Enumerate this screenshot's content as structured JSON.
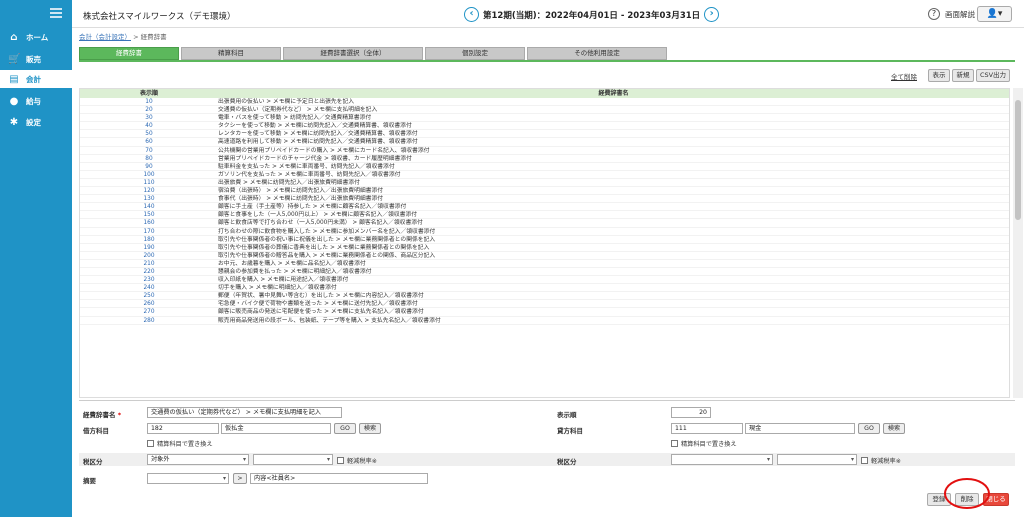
{
  "sidebar": {
    "items": [
      {
        "label": "ホーム",
        "icon": "home-icon",
        "glyph": "⌂"
      },
      {
        "label": "販売",
        "icon": "cart-icon",
        "glyph": "🛒"
      },
      {
        "label": "会計",
        "icon": "document-icon",
        "glyph": "▤"
      },
      {
        "label": "給与",
        "icon": "money-bag-icon",
        "glyph": "●"
      },
      {
        "label": "設定",
        "icon": "gear-icon",
        "glyph": "✱"
      }
    ]
  },
  "header": {
    "company": "株式会社スマイルワークス（デモ環境）",
    "period": "第12期(当期)：2022年04月01日 - 2023年03月31日",
    "prev": "‹",
    "next": "›",
    "help": "画面解説",
    "help_glyph": "?",
    "user_glyph": "👤▾"
  },
  "breadcrumb": {
    "link": "会計（会計設定）",
    "sep": " > ",
    "current": "経費辞書"
  },
  "tabs": [
    "経費辞書",
    "精算科目",
    "経費辞書選択（全体）",
    "個別設定",
    "その他利用設定"
  ],
  "toolbar": {
    "delete_all": "全て削除",
    "show": "表示",
    "new": "新規",
    "csv": "CSV出力"
  },
  "table": {
    "headers": [
      "表示順",
      "経費辞書名"
    ],
    "rows": [
      [
        "10",
        "出張費用の仮払い > メモ欄に予定日と出張先を記入"
      ],
      [
        "20",
        "交通費の仮払い（定期券代など） > メモ欄に支払明細を記入"
      ],
      [
        "30",
        "電車・バスを使って移動 > 訪問先記入／交通費精算書添付"
      ],
      [
        "40",
        "タクシーを使って移動 > メモ欄に訪問先記入／交通費精算書、領収書添付"
      ],
      [
        "50",
        "レンタカーを使って移動 > メモ欄に訪問先記入／交通費精算書、領収書添付"
      ],
      [
        "60",
        "高速道路を利用して移動 > メモ欄に訪問先記入／交通費精算書、領収書添付"
      ],
      [
        "70",
        "公共機関の営業用プリペイドカードの購入 > メモ欄にカード名記入、領収書添付"
      ],
      [
        "80",
        "営業用プリペイドカードのチャージ代金 > 領収書、カード履歴明細書添付"
      ],
      [
        "90",
        "駐車料金を支払った > メモ欄に車両番号、訪問先記入／領収書添付"
      ],
      [
        "100",
        "ガソリン代を支払った > メモ欄に車両番号、訪問先記入／領収書添付"
      ],
      [
        "110",
        "出張旅費 > メモ欄に訪問先記入／出張旅費明細書添付"
      ],
      [
        "120",
        "宿泊費（出張時） > メモ欄に訪問先記入／出張旅費明細書添付"
      ],
      [
        "130",
        "食事代（出張時） > メモ欄に訪問先記入／出張旅費明細書添付"
      ],
      [
        "140",
        "顧客に手土産（手土産等）持参した > メモ欄に顧客名記入／領収書添付"
      ],
      [
        "150",
        "顧客と食事をした（一人5,000円以上） > メモ欄に顧客名記入／領収書添付"
      ],
      [
        "160",
        "顧客と飲食店等で打ち合わせ（一人5,000円未満） > 顧客名記入／領収書添付"
      ],
      [
        "170",
        "打ち合わせの際に飲食物を購入した > メモ欄に参加メンバー名を記入／領収書添付"
      ],
      [
        "180",
        "取引先や仕事関係者の祝い事に祝儀を出した > メモ欄に業務関係者との関係を記入"
      ],
      [
        "190",
        "取引先や仕事関係者の葬儀に香典を出した > メモ欄に業務関係者との関係を記入"
      ],
      [
        "200",
        "取引先や仕事関係者の贈答品を購入 > メモ欄に業務関係者との関係、商品区分記入"
      ],
      [
        "210",
        "お中元、お歳暮を購入 > メモ欄に品名記入／領収書添付"
      ],
      [
        "220",
        "懇親会の参加費を払った > メモ欄に明細記入／領収書添付"
      ],
      [
        "230",
        "収入印紙を購入 > メモ欄に用途記入／領収書添付"
      ],
      [
        "240",
        "切手を購入 > メモ欄に明細記入／領収書添付"
      ],
      [
        "250",
        "郵便（年賀状、暑中見舞い等含む）を出した > メモ欄に内容記入／領収書添付"
      ],
      [
        "260",
        "宅急便・バイク便で荷物や書類を送った > メモ欄に送付先記入／領収書添付"
      ],
      [
        "270",
        "顧客に販売商品の発送に宅配便を使った > メモ欄に支払先名記入／領収書添付"
      ],
      [
        "280",
        "販売用商品発送用の段ボール、包装紙、テープ等を購入 > 支払先名記入／領収書添付"
      ]
    ]
  },
  "form": {
    "name_label": "経費辞書名",
    "required_mark": "*",
    "name_value": "交通費の仮払い（定期券代など） > メモ欄に支払明細を記入",
    "order_label": "表示順",
    "order_value": "20",
    "debit_label": "借方科目",
    "debit_code": "182",
    "debit_name": "仮払金",
    "credit_label": "貸方科目",
    "credit_code": "111",
    "credit_name": "現金",
    "go": "GO",
    "search": "検索",
    "replace_label": "精算科目で置き換え",
    "tax_label": "税区分",
    "tax_debit": "対象外",
    "reduced_label": "軽減税率※",
    "memo_label": "摘要",
    "memo_arrow": ">",
    "memo_value": "内容<社員名>",
    "register": "登録",
    "delete": "削除",
    "close": "閉じる"
  },
  "colors": {
    "sidebar": "#1f93c6",
    "tab_active": "#5cb85c",
    "header_row": "#dcefd4",
    "close_button": "#e8483b",
    "highlight_circle": "#e21010"
  }
}
